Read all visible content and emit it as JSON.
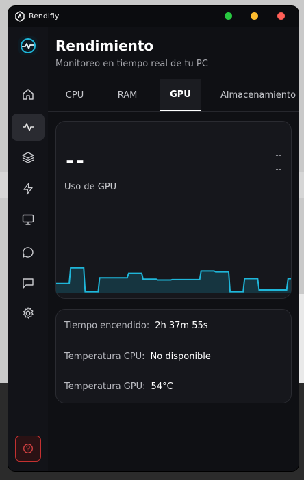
{
  "window": {
    "app_name": "Rendifly",
    "controls": {
      "maximize_color": "#28c840",
      "minimize_color": "#febc2e",
      "close_color": "#ff5f57"
    }
  },
  "sidebar": {
    "items": [
      {
        "icon": "home-icon"
      },
      {
        "icon": "activity-icon",
        "active": true
      },
      {
        "icon": "layers-icon"
      },
      {
        "icon": "lightning-icon"
      },
      {
        "icon": "monitor-icon"
      },
      {
        "icon": "chat-circle-icon"
      },
      {
        "icon": "chat-square-icon"
      },
      {
        "icon": "gear-icon"
      }
    ],
    "help_icon": "help-icon",
    "accent": "#1fb6d9",
    "danger": "#c43131"
  },
  "header": {
    "title": "Rendimiento",
    "subtitle": "Monitoreo en tiempo real de tu PC"
  },
  "tabs": [
    {
      "label": "CPU"
    },
    {
      "label": "RAM"
    },
    {
      "label": "GPU",
      "active": true
    },
    {
      "label": "Almacenamiento"
    }
  ],
  "gpu_card": {
    "value": "--",
    "right_top": "--",
    "right_bottom": "--",
    "label": "Uso de GPU",
    "chart_color": "#1fb6d9",
    "chart_fill": "#163540"
  },
  "chart_data": {
    "type": "line",
    "values": [
      20,
      20,
      20,
      20,
      20,
      20,
      20,
      20,
      20,
      20,
      55,
      55,
      55,
      55,
      55,
      55,
      55,
      55,
      55,
      55,
      2,
      2,
      2,
      2,
      2,
      2,
      2,
      2,
      2,
      2,
      33,
      33,
      33,
      33,
      33,
      33,
      33,
      33,
      33,
      33,
      33,
      33,
      33,
      33,
      33,
      33,
      33,
      33,
      33,
      33,
      43,
      43,
      43,
      43,
      43,
      43,
      43,
      43,
      43,
      43,
      30,
      30,
      30,
      30,
      30,
      30,
      30,
      30,
      30,
      30,
      28,
      28,
      28,
      28,
      28,
      28,
      28,
      28,
      28,
      28,
      29,
      29,
      29,
      29,
      29,
      29,
      29,
      29,
      29,
      29,
      29,
      29,
      29,
      29,
      29,
      29,
      29,
      29,
      29,
      29,
      48,
      48,
      48,
      48,
      48,
      48,
      48,
      48,
      48,
      48,
      46,
      46,
      46,
      46,
      46,
      46,
      46,
      46,
      46,
      46,
      2,
      2,
      2,
      2,
      2,
      2,
      2,
      2,
      2,
      2,
      31,
      31,
      31,
      31,
      31,
      31,
      31,
      31,
      31,
      31,
      6,
      6,
      6,
      6,
      6,
      6,
      6,
      6,
      6,
      6,
      6,
      6,
      6,
      6,
      6,
      6,
      6,
      6,
      6,
      6,
      31,
      31,
      31
    ],
    "ylim": [
      0,
      100
    ]
  },
  "info_card": {
    "rows": [
      {
        "label": "Tiempo encendido:",
        "value": "2h 37m 55s"
      },
      {
        "label": "Temperatura CPU:",
        "value": "No disponible"
      },
      {
        "label": "Temperatura GPU:",
        "value": "54°C"
      }
    ]
  }
}
